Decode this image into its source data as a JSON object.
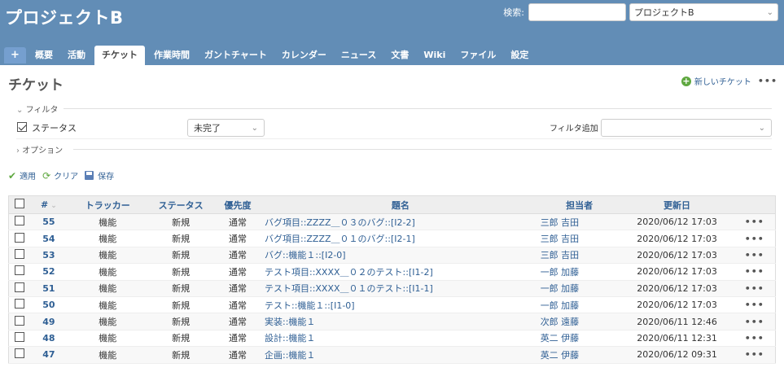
{
  "header": {
    "project_title": "プロジェクトB",
    "search_label": "検索:",
    "search_value": "",
    "project_jump": "プロジェクトB"
  },
  "menu": {
    "new_label": "+",
    "tabs": [
      "概要",
      "活動",
      "チケット",
      "作業時間",
      "ガントチャート",
      "カレンダー",
      "ニュース",
      "文書",
      "Wiki",
      "ファイル",
      "設定"
    ],
    "selected": "チケット"
  },
  "page": {
    "title": "チケット",
    "new_issue_label": "新しいチケット",
    "more_label": "•••"
  },
  "filters": {
    "legend": "フィルタ",
    "status_label": "ステータス",
    "status_checked": true,
    "status_operator": "未完了",
    "add_filter_label": "フィルタ追加",
    "add_filter_value": "",
    "options_legend": "オプション"
  },
  "query_buttons": {
    "apply": "適用",
    "clear": "クリア",
    "save": "保存"
  },
  "table": {
    "headers": [
      "#",
      "トラッカー",
      "ステータス",
      "優先度",
      "題名",
      "担当者",
      "更新日"
    ],
    "rows": [
      {
        "id": "55",
        "tracker": "機能",
        "status": "新規",
        "priority": "通常",
        "subject": "バグ項目::ZZZZ＿０３のバグ::[I2-2]",
        "assigned": "三郎 吉田",
        "updated": "2020/06/12 17:03"
      },
      {
        "id": "54",
        "tracker": "機能",
        "status": "新規",
        "priority": "通常",
        "subject": "バグ項目::ZZZZ＿０１のバグ::[I2-1]",
        "assigned": "三郎 吉田",
        "updated": "2020/06/12 17:03"
      },
      {
        "id": "53",
        "tracker": "機能",
        "status": "新規",
        "priority": "通常",
        "subject": "バグ::機能１::[I2-0]",
        "assigned": "三郎 吉田",
        "updated": "2020/06/12 17:03"
      },
      {
        "id": "52",
        "tracker": "機能",
        "status": "新規",
        "priority": "通常",
        "subject": "テスト項目::XXXX＿０２のテスト::[I1-2]",
        "assigned": "一郎 加藤",
        "updated": "2020/06/12 17:03"
      },
      {
        "id": "51",
        "tracker": "機能",
        "status": "新規",
        "priority": "通常",
        "subject": "テスト項目::XXXX＿０１のテスト::[I1-1]",
        "assigned": "一郎 加藤",
        "updated": "2020/06/12 17:03"
      },
      {
        "id": "50",
        "tracker": "機能",
        "status": "新規",
        "priority": "通常",
        "subject": "テスト::機能１::[I1-0]",
        "assigned": "一郎 加藤",
        "updated": "2020/06/12 17:03"
      },
      {
        "id": "49",
        "tracker": "機能",
        "status": "新規",
        "priority": "通常",
        "subject": "実装::機能１",
        "assigned": "次郎 遠藤",
        "updated": "2020/06/11 12:46"
      },
      {
        "id": "48",
        "tracker": "機能",
        "status": "新規",
        "priority": "通常",
        "subject": "設計::機能１",
        "assigned": "英二 伊藤",
        "updated": "2020/06/11 12:31"
      },
      {
        "id": "47",
        "tracker": "機能",
        "status": "新規",
        "priority": "通常",
        "subject": "企画::機能１",
        "assigned": "英二 伊藤",
        "updated": "2020/06/12 09:31"
      }
    ],
    "row_actions_label": "•••"
  }
}
